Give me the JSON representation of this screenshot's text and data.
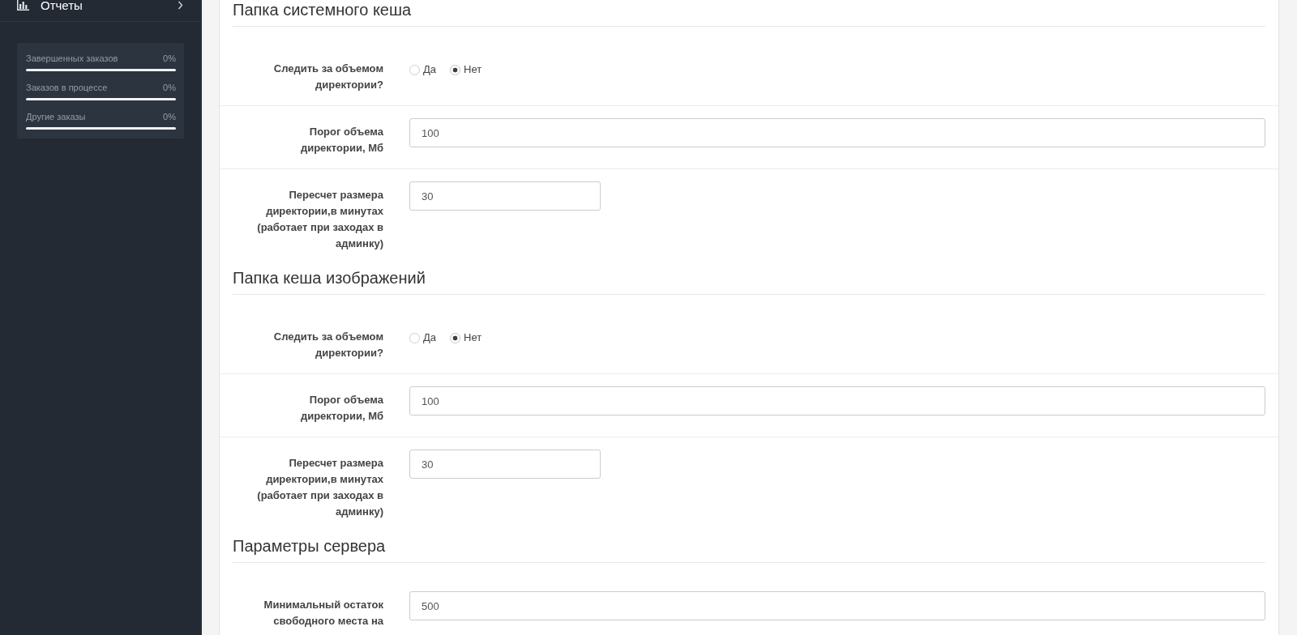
{
  "sidebar": {
    "menu": [
      {
        "label": "Отчеты",
        "expanded": false
      }
    ],
    "stats": [
      {
        "label": "Завершенных заказов",
        "reading": "0%"
      },
      {
        "label": "Заказов в процессе",
        "reading": "0%"
      },
      {
        "label": "Другие заказы",
        "reading": "0%"
      }
    ]
  },
  "sections": [
    {
      "title": "Папка системного кеша",
      "fields": [
        {
          "kind": "radio",
          "label": "Следить за объемом директории?",
          "options": [
            {
              "label": "Да",
              "selected": false
            },
            {
              "label": "Нет",
              "selected": true
            }
          ]
        },
        {
          "kind": "input",
          "label": "Порог объема директории, Мб",
          "value": "100"
        },
        {
          "kind": "compact",
          "label": "Пересчет размера директории,в минутах (работает при заходах в админку)",
          "value": "30"
        }
      ]
    },
    {
      "title": "Папка кеша изображений",
      "fields": [
        {
          "kind": "radio",
          "label": "Следить за объемом директории?",
          "options": [
            {
              "label": "Да",
              "selected": false
            },
            {
              "label": "Нет",
              "selected": true
            }
          ]
        },
        {
          "kind": "input",
          "label": "Порог объема директории, Мб",
          "value": "100"
        },
        {
          "kind": "compact",
          "label": "Пересчет размера директории,в минутах (работает при заходах в админку)",
          "value": "30"
        }
      ]
    },
    {
      "title": "Параметры сервера",
      "fields": [
        {
          "kind": "input",
          "label": "Минимальный остаток свободного места на",
          "value": "500"
        }
      ]
    }
  ]
}
